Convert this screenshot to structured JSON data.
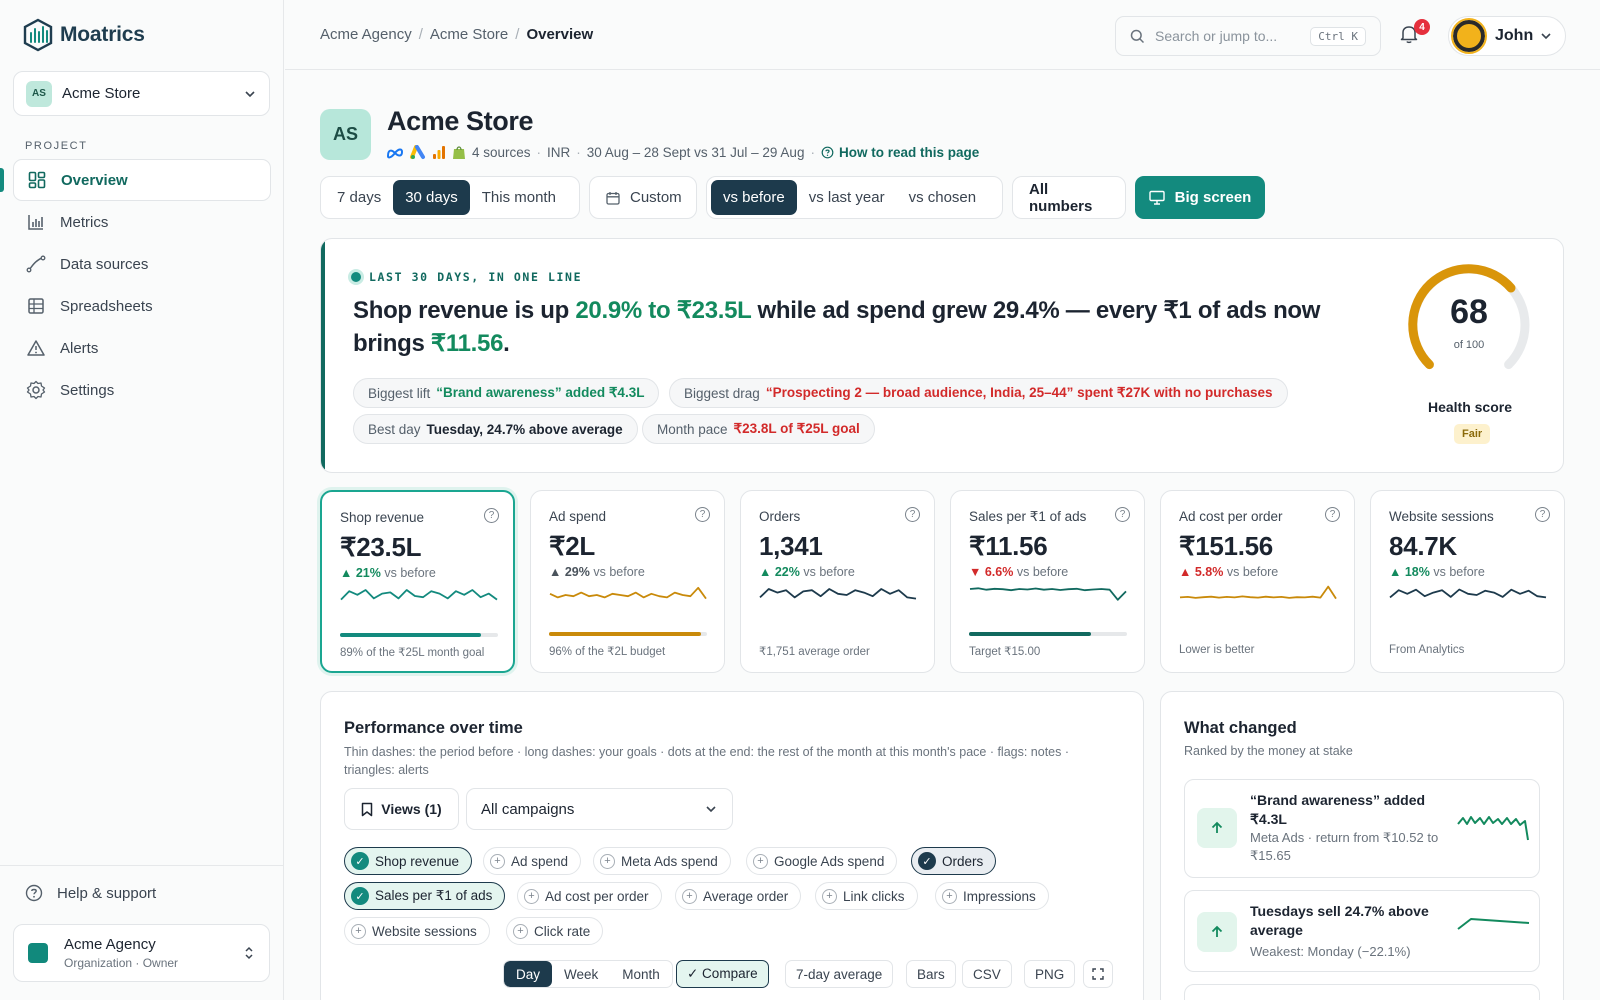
{
  "app": {
    "name": "Moatrics"
  },
  "sidebar": {
    "store": {
      "initials": "AS",
      "name": "Acme Store"
    },
    "section_label": "PROJECT",
    "items": [
      {
        "label": "Overview",
        "icon": "overview-icon",
        "active": true
      },
      {
        "label": "Metrics",
        "icon": "metrics-icon"
      },
      {
        "label": "Data sources",
        "icon": "data-sources-icon"
      },
      {
        "label": "Spreadsheets",
        "icon": "spreadsheets-icon"
      },
      {
        "label": "Alerts",
        "icon": "alert-icon"
      },
      {
        "label": "Settings",
        "icon": "gear-icon"
      }
    ],
    "help": "Help & support",
    "org": {
      "name": "Acme Agency",
      "role": "Organization · Owner"
    }
  },
  "topbar": {
    "breadcrumb": [
      "Acme Agency",
      "Acme Store",
      "Overview"
    ],
    "search_placeholder": "Search or jump to...",
    "search_kbd": "Ctrl K",
    "notifications": "4",
    "user": "John"
  },
  "header": {
    "initials": "AS",
    "title": "Acme Store",
    "sources": "4 sources",
    "currency": "INR",
    "range": "30 Aug – 28 Sept vs 31 Jul – 29 Aug",
    "help_link": "How to read this page"
  },
  "filters": {
    "periods": [
      "7 days",
      "30 days",
      "This month"
    ],
    "custom": "Custom",
    "compare": [
      "vs before",
      "vs last year",
      "vs chosen"
    ],
    "all_numbers": "All numbers",
    "big_screen": "Big screen"
  },
  "summary": {
    "tag": "LAST 30 DAYS, IN ONE LINE",
    "h1": "Shop revenue is up ",
    "h2": "20.9% to ₹23.5L",
    "h3": " while ad spend grew 29.4% — every ₹1 of ads now brings ",
    "h4": "₹11.56",
    "h5": ".",
    "chips": [
      {
        "label": "Biggest lift",
        "value": "“Brand awareness” added ₹4.3L"
      },
      {
        "label": "Biggest drag",
        "value": "“Prospecting 2 — broad audience, India, 25–44” spent ₹27K with no purchases"
      },
      {
        "label": "Best day",
        "value": "Tuesday, 24.7% above average"
      },
      {
        "label": "Month pace",
        "value": "₹23.8L of ₹25L goal"
      }
    ],
    "health": {
      "score": 68,
      "score_text": "68",
      "of": "of 100",
      "label": "Health score",
      "status": "Fair"
    }
  },
  "kpis": [
    {
      "title": "Shop revenue",
      "value": "₹23.5L",
      "delta": "21%",
      "vs": "vs before",
      "dir": "up",
      "progress": 0.89,
      "bar_color": "#138a7e",
      "footer": "89% of the ₹25L month goal",
      "spark": [
        0.35,
        0.7,
        0.55,
        0.75,
        0.4,
        0.6,
        0.65,
        0.4,
        0.75,
        0.5,
        0.45,
        0.7,
        0.6,
        0.4,
        0.7,
        0.55,
        0.75,
        0.45,
        0.6,
        0.35
      ],
      "color": "#138a7e"
    },
    {
      "title": "Ad spend",
      "value": "₹2L",
      "delta": "29%",
      "vs": "vs before",
      "dir": "neutral",
      "progress": 0.96,
      "bar_color": "#c98a0a",
      "footer": "96% of the ₹2L budget",
      "spark": [
        0.55,
        0.4,
        0.5,
        0.45,
        0.6,
        0.45,
        0.5,
        0.4,
        0.55,
        0.5,
        0.45,
        0.6,
        0.4,
        0.55,
        0.45,
        0.4,
        0.6,
        0.5,
        0.45,
        0.8,
        0.35
      ],
      "color": "#c98a0a"
    },
    {
      "title": "Orders",
      "value": "1,341",
      "delta": "22%",
      "vs": "vs before",
      "dir": "up",
      "progress": null,
      "footer": "₹1,751 average order",
      "spark": [
        0.4,
        0.75,
        0.6,
        0.7,
        0.4,
        0.65,
        0.7,
        0.45,
        0.75,
        0.55,
        0.5,
        0.7,
        0.6,
        0.45,
        0.75,
        0.55,
        0.7,
        0.4,
        0.35
      ],
      "color": "#1d3a4c"
    },
    {
      "title": "Sales per ₹1 of ads",
      "value": "₹11.56",
      "delta": "6.6%",
      "vs": "vs before",
      "dir": "down",
      "progress": 0.77,
      "bar_color": "#11695f",
      "footer": "Target ₹15.00",
      "spark": [
        0.75,
        0.78,
        0.72,
        0.76,
        0.74,
        0.7,
        0.75,
        0.73,
        0.77,
        0.72,
        0.75,
        0.71,
        0.74,
        0.76,
        0.7,
        0.73,
        0.75,
        0.72,
        0.3,
        0.65
      ],
      "color": "#11695f"
    },
    {
      "title": "Ad cost per order",
      "value": "₹151.56",
      "delta": "5.8%",
      "vs": "vs before",
      "dir": "upbad",
      "progress": null,
      "footer": "Lower is better",
      "spark": [
        0.4,
        0.42,
        0.38,
        0.41,
        0.43,
        0.39,
        0.42,
        0.4,
        0.44,
        0.41,
        0.39,
        0.43,
        0.4,
        0.42,
        0.38,
        0.41,
        0.4,
        0.43,
        0.39,
        0.85,
        0.35
      ],
      "color": "#c98a0a"
    },
    {
      "title": "Website sessions",
      "value": "84.7K",
      "delta": "18%",
      "vs": "vs before",
      "dir": "up",
      "progress": null,
      "footer": "From Analytics",
      "spark": [
        0.4,
        0.7,
        0.55,
        0.72,
        0.45,
        0.6,
        0.7,
        0.42,
        0.73,
        0.55,
        0.5,
        0.68,
        0.6,
        0.42,
        0.72,
        0.55,
        0.68,
        0.45,
        0.4
      ],
      "color": "#1d3a4c"
    }
  ],
  "performance": {
    "title": "Performance over time",
    "subtitle": "Thin dashes: the period before · long dashes: your goals · dots at the end: the rest of the month at this month's pace · flags: notes · triangles: alerts",
    "views": "Views (1)",
    "campaigns": "All campaigns",
    "metrics": [
      {
        "label": "Shop revenue",
        "on": "A"
      },
      {
        "label": "Ad spend"
      },
      {
        "label": "Meta Ads spend"
      },
      {
        "label": "Google Ads spend"
      },
      {
        "label": "Orders",
        "on": "B"
      },
      {
        "label": "Sales per ₹1 of ads",
        "on": "A"
      },
      {
        "label": "Ad cost per order"
      },
      {
        "label": "Average order"
      },
      {
        "label": "Link clicks"
      },
      {
        "label": "Impressions"
      },
      {
        "label": "Website sessions"
      },
      {
        "label": "Click rate"
      }
    ],
    "granularity": [
      "Day",
      "Week",
      "Month"
    ],
    "compare": "✓ Compare",
    "avg": "7-day average",
    "bars": "Bars",
    "csv": "CSV",
    "png": "PNG"
  },
  "what_changed": {
    "title": "What changed",
    "subtitle": "Ranked by the money at stake",
    "items": [
      {
        "title": "“Brand awareness” added ₹4.3L",
        "detail": "Meta Ads · return from ₹10.52 to ₹15.65"
      },
      {
        "title": "Tuesdays sell 24.7% above average",
        "detail": "Weakest: Monday (−22.1%)"
      }
    ]
  },
  "colors": {
    "accent": "#138a7e",
    "dark": "#1d3a4c",
    "up": "#138a5e",
    "down": "#d22a2a",
    "gauge": "#d9950a"
  }
}
